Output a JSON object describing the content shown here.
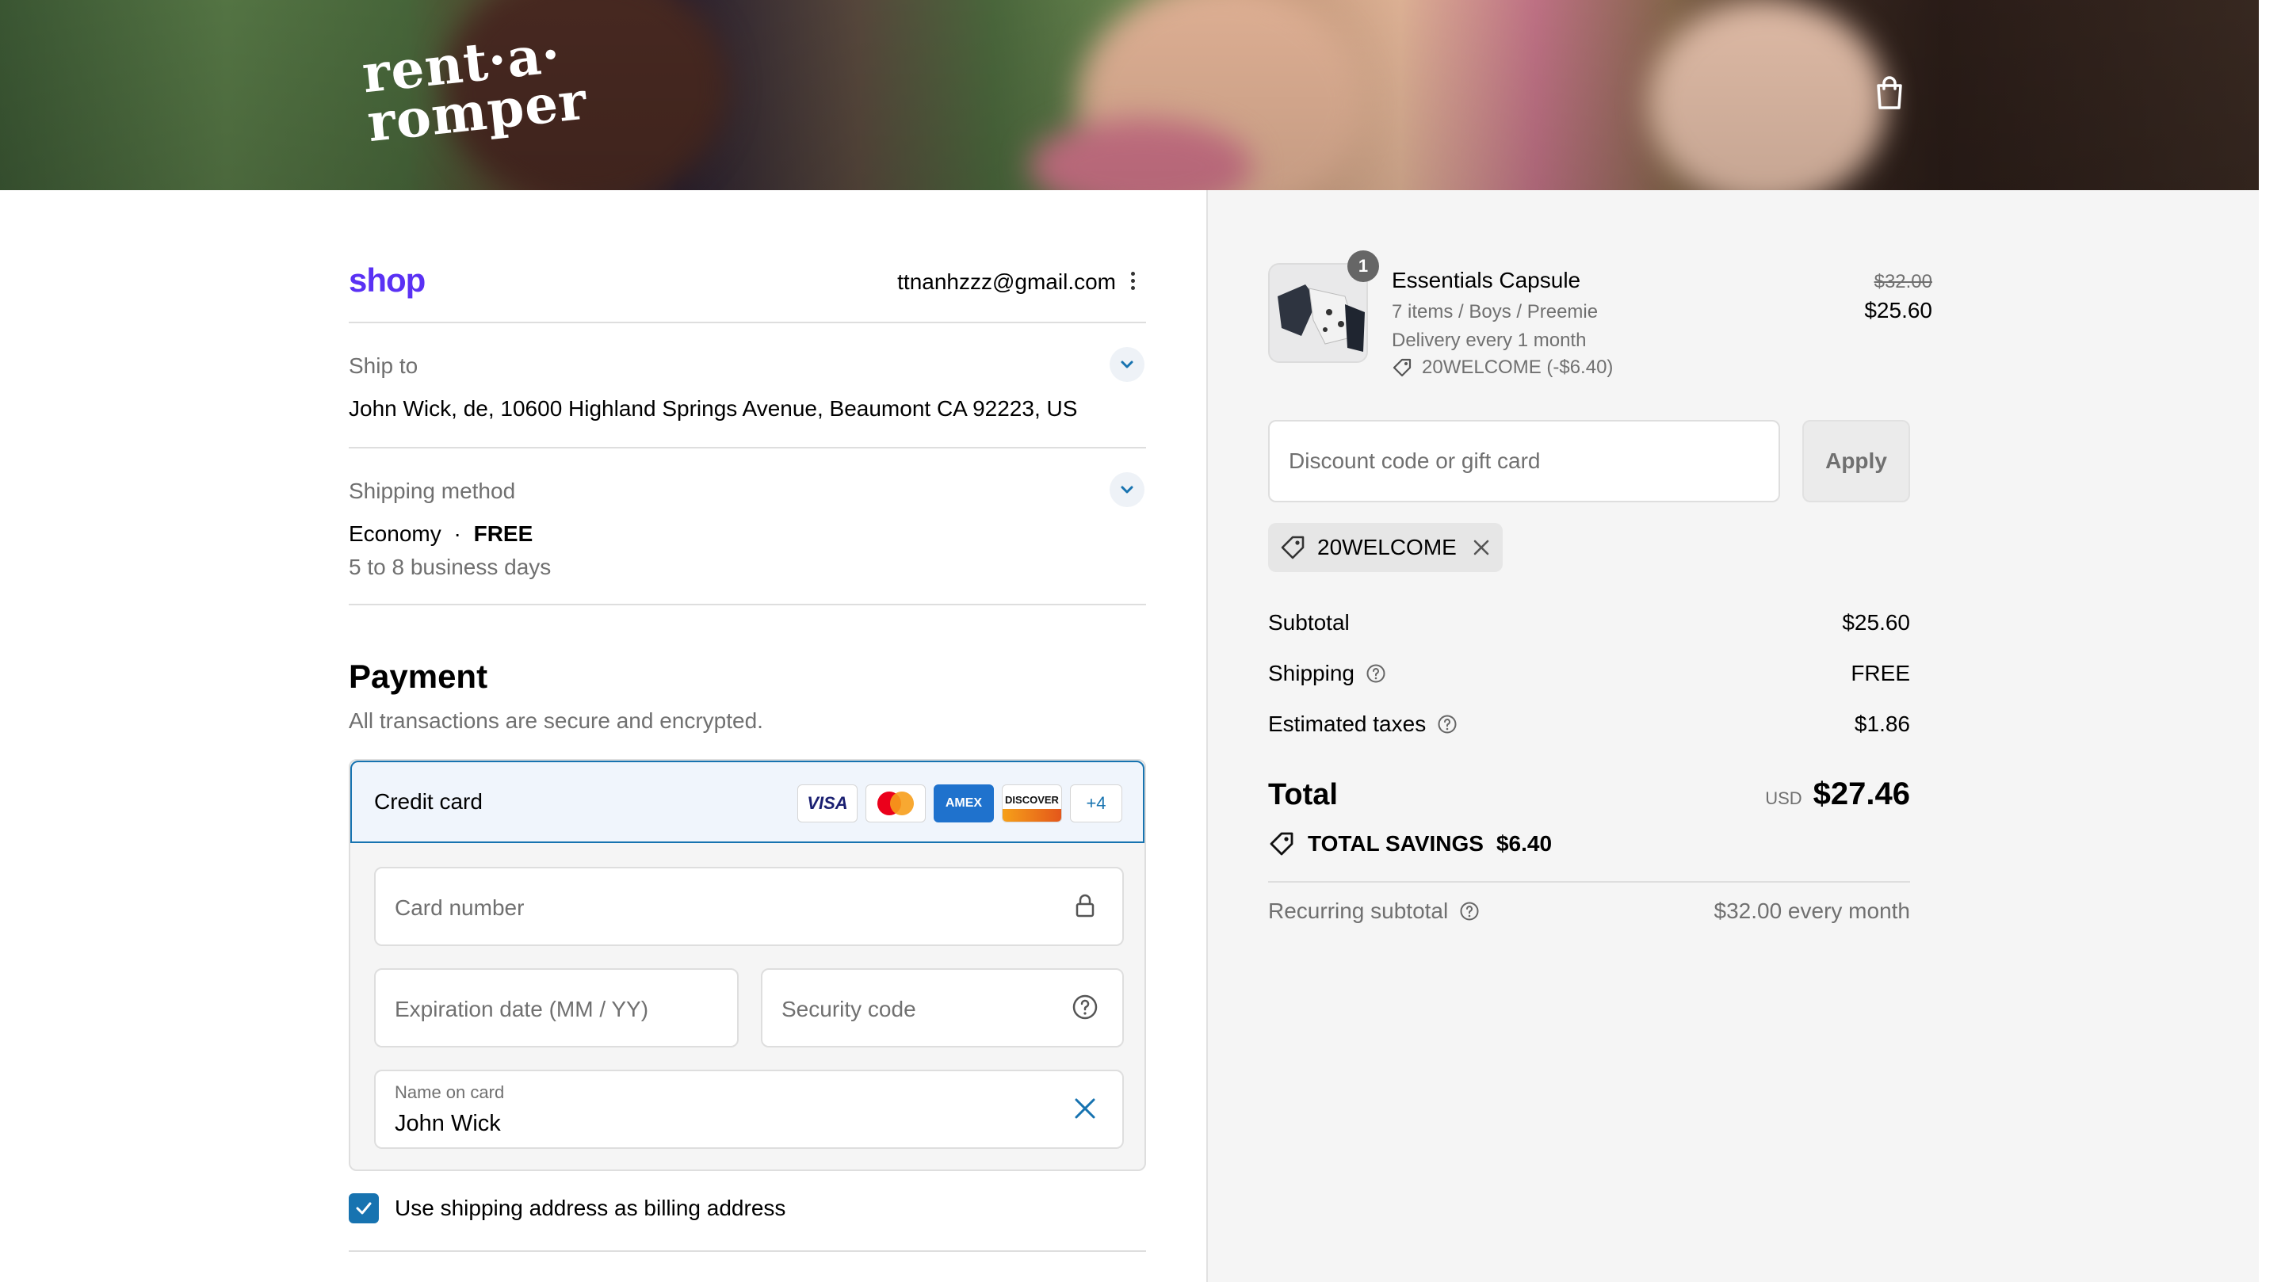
{
  "header": {
    "logo_line1": "rent·a·",
    "logo_line2": "romper",
    "cart_icon": "shopping-bag-icon"
  },
  "checkout": {
    "shop_label": "shop",
    "email": "ttnanhzzz@gmail.com",
    "ship_to": {
      "label": "Ship to",
      "value": "John Wick, de, 10600 Highland Springs Avenue, Beaumont CA 92223, US"
    },
    "shipping_method": {
      "label": "Shipping method",
      "name": "Economy",
      "separator": "·",
      "price": "FREE",
      "eta": "5 to 8 business days"
    },
    "payment": {
      "title": "Payment",
      "subtitle": "All transactions are secure and encrypted.",
      "method_label": "Credit card",
      "card_brands": [
        "VISA",
        "Mastercard",
        "AMEX",
        "DISCOVER"
      ],
      "more_brands": "+4",
      "card_number_placeholder": "Card number",
      "expiration_placeholder": "Expiration date (MM / YY)",
      "security_placeholder": "Security code",
      "name_label": "Name on card",
      "name_value": "John Wick",
      "billing_checkbox_label": "Use shipping address as billing address",
      "billing_checked": true
    }
  },
  "summary": {
    "product": {
      "quantity": "1",
      "title": "Essentials Capsule",
      "variant": "7 items / Boys / Preemie",
      "delivery": "Delivery every 1 month",
      "discount": "20WELCOME (-$6.40)",
      "price_original": "$32.00",
      "price_final": "$25.60"
    },
    "discount_placeholder": "Discount code or gift card",
    "apply_label": "Apply",
    "applied_code": "20WELCOME",
    "subtotal_label": "Subtotal",
    "subtotal_value": "$25.60",
    "shipping_label": "Shipping",
    "shipping_value": "FREE",
    "taxes_label": "Estimated taxes",
    "taxes_value": "$1.86",
    "total_label": "Total",
    "currency": "USD",
    "total_value": "$27.46",
    "savings_label": "TOTAL SAVINGS",
    "savings_value": "$6.40",
    "recurring_label": "Recurring subtotal",
    "recurring_value": "$32.00 every month"
  },
  "colors": {
    "accent": "#1773b0",
    "shop_purple": "#5a31f4",
    "muted_text": "#707070"
  }
}
